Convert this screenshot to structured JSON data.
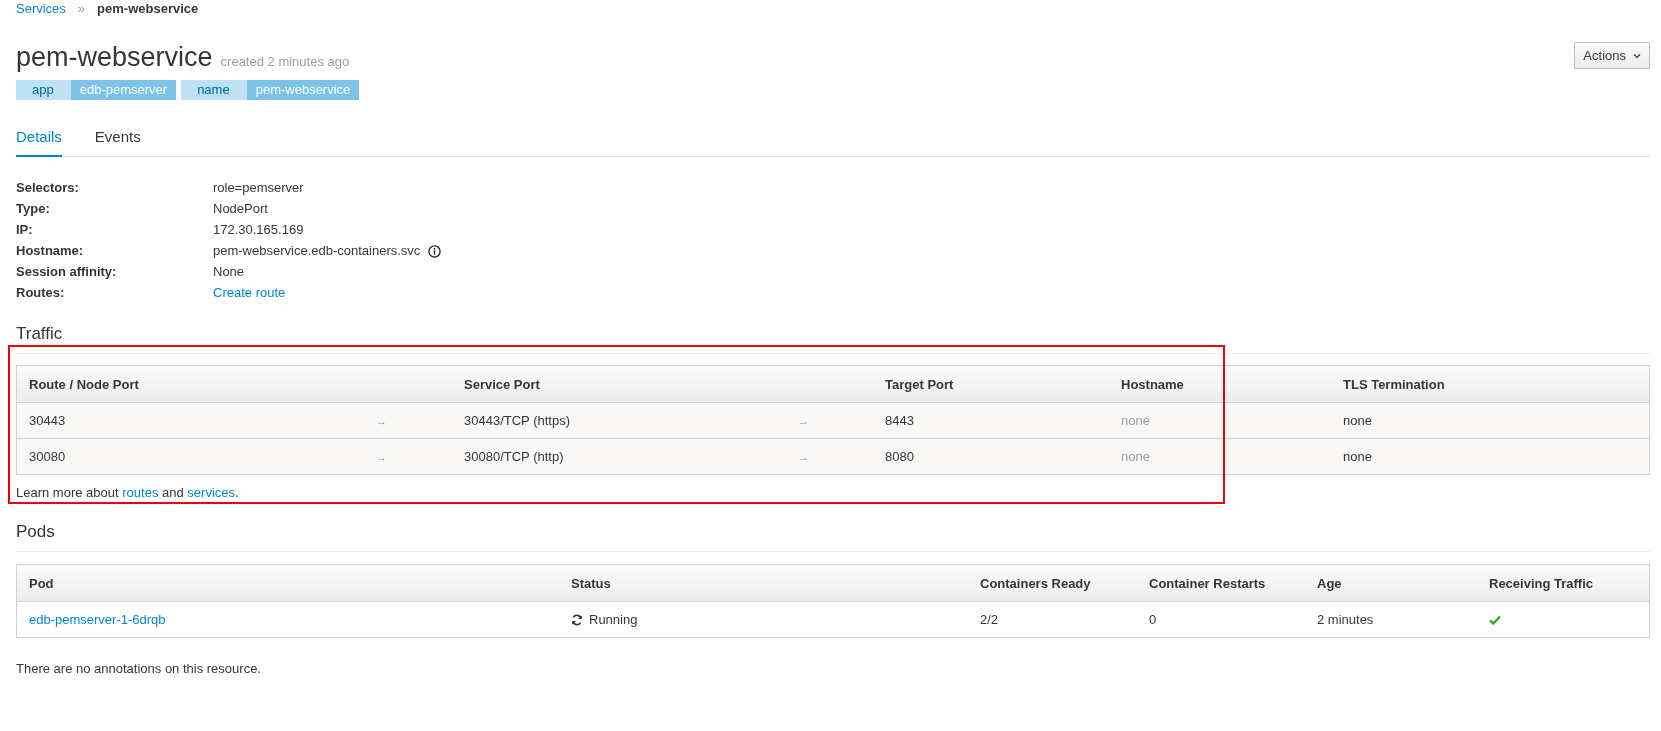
{
  "breadcrumb": {
    "parent": "Services",
    "separator": "»",
    "current": "pem-webservice"
  },
  "header": {
    "title": "pem-webservice",
    "subtitle": "created 2 minutes ago",
    "actions": "Actions"
  },
  "labels": [
    {
      "key": "app",
      "value": "edb-pemserver"
    },
    {
      "key": "name",
      "value": "pem-webservice"
    }
  ],
  "tabs": [
    {
      "label": "Details",
      "selected": true
    },
    {
      "label": "Events",
      "selected": false
    }
  ],
  "details": [
    {
      "label": "Selectors:",
      "value": "role=pemserver",
      "kind": "text"
    },
    {
      "label": "Type:",
      "value": "NodePort",
      "kind": "text"
    },
    {
      "label": "IP:",
      "value": "172.30.165.169",
      "kind": "text"
    },
    {
      "label": "Hostname:",
      "value": "pem-webservice.edb-containers.svc",
      "kind": "info"
    },
    {
      "label": "Session affinity:",
      "value": "None",
      "kind": "text"
    },
    {
      "label": "Routes:",
      "value": "Create route",
      "kind": "link"
    }
  ],
  "traffic": {
    "heading": "Traffic",
    "highlighted": true,
    "columns": [
      "Route / Node Port",
      "Service Port",
      "Target Port",
      "Hostname",
      "TLS Termination"
    ],
    "rows": [
      {
        "route": "30443",
        "arrow_1": "→",
        "service": "30443/TCP (https)",
        "arrow_2": "→",
        "target": "8443",
        "hostname": "none",
        "tls": "none"
      },
      {
        "route": "30080",
        "arrow_1": "→",
        "service": "30080/TCP (http)",
        "arrow_2": "→",
        "target": "8080",
        "hostname": "none",
        "tls": "none"
      }
    ],
    "learn_more": {
      "before": "Learn more about",
      "link_1": "routes",
      "middle": "and",
      "link_2": "services",
      "after": "."
    }
  },
  "pods": {
    "heading": "Pods",
    "columns": [
      "Pod",
      "Status",
      "Containers Ready",
      "Container Restarts",
      "Age",
      "Receiving Traffic"
    ],
    "rows": [
      {
        "pod": "edb-pemserver-1-6drqb",
        "status": "Running",
        "ready": "2/2",
        "restarts": "0",
        "age": "2 minutes",
        "receiving": true
      }
    ]
  },
  "footer": "There are no annotations on this resource."
}
